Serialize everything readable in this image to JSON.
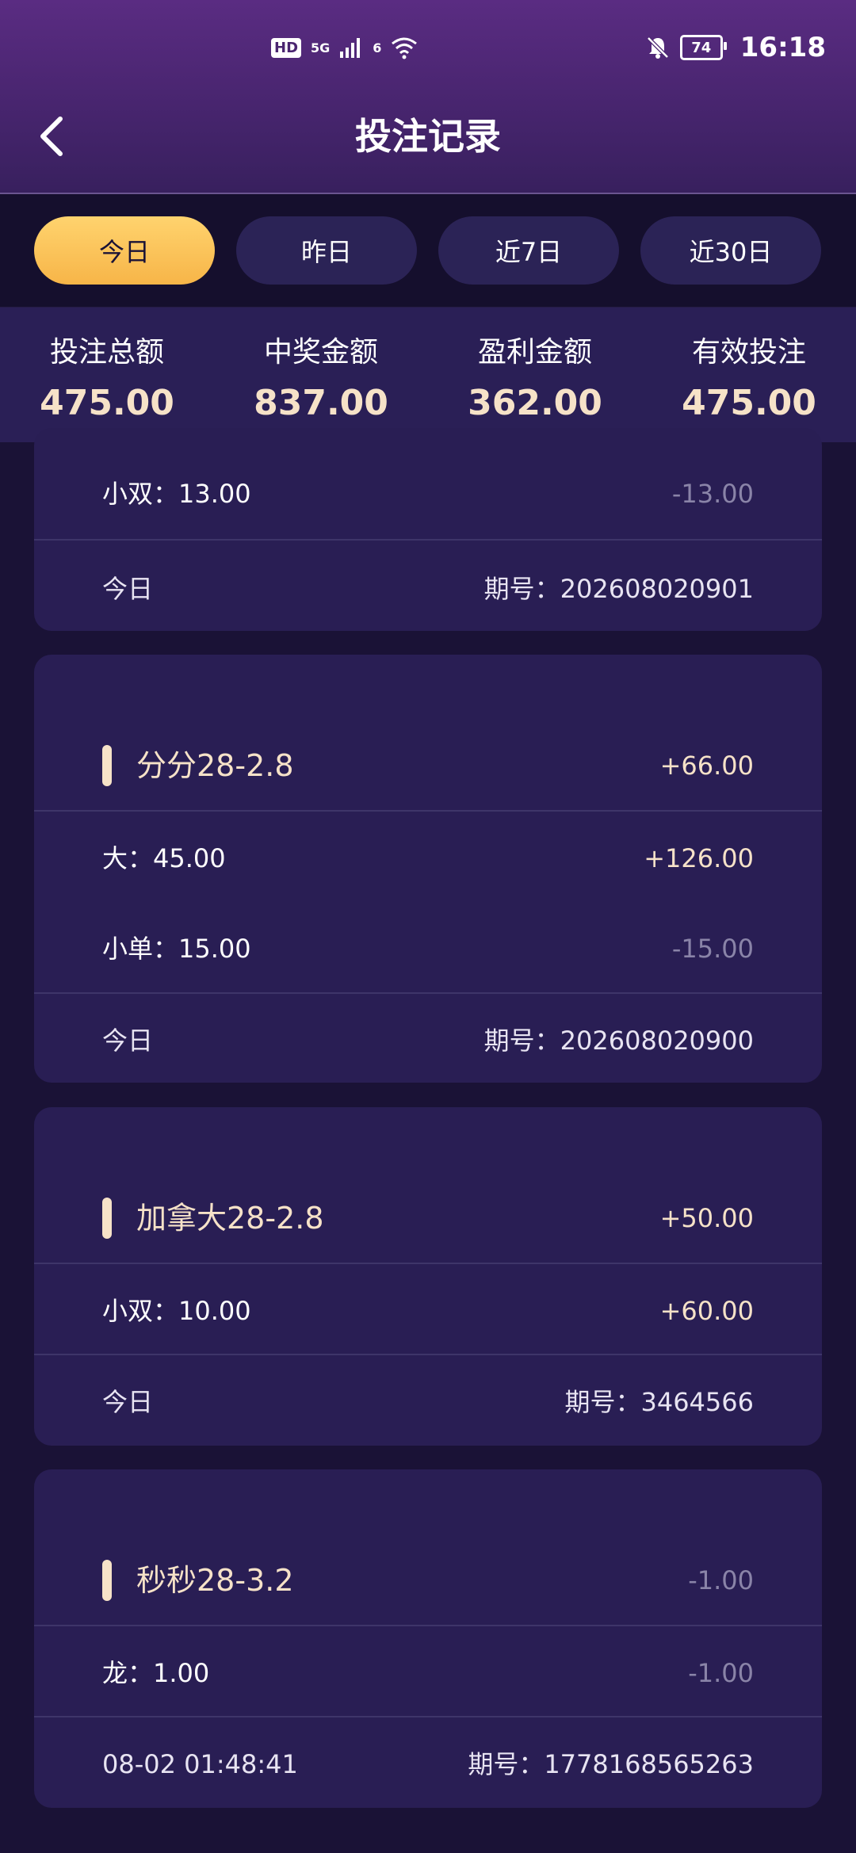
{
  "status_bar": {
    "hd": "HD",
    "network": "5G",
    "wifi_label": "6",
    "battery": "74",
    "time": "16:18"
  },
  "header": {
    "title": "投注记录"
  },
  "tabs": [
    {
      "label": "今日",
      "active": true
    },
    {
      "label": "昨日",
      "active": false
    },
    {
      "label": "近7日",
      "active": false
    },
    {
      "label": "近30日",
      "active": false
    }
  ],
  "summary": [
    {
      "label": "投注总额",
      "value": "475.00"
    },
    {
      "label": "中奖金额",
      "value": "837.00"
    },
    {
      "label": "盈利金额",
      "value": "362.00"
    },
    {
      "label": "有效投注",
      "value": "475.00"
    }
  ],
  "records": [
    {
      "bets": [
        {
          "label": "小双：13.00",
          "amount": "-13.00"
        }
      ],
      "date": "今日",
      "period": "期号：202608020901"
    },
    {
      "title": "分分28-2.8",
      "total": "+66.00",
      "bets": [
        {
          "label": "大：45.00",
          "amount": "+126.00"
        },
        {
          "label": "小单：15.00",
          "amount": "-15.00"
        }
      ],
      "date": "今日",
      "period": "期号：202608020900"
    },
    {
      "title": "加拿大28-2.8",
      "total": "+50.00",
      "bets": [
        {
          "label": "小双：10.00",
          "amount": "+60.00"
        }
      ],
      "date": "今日",
      "period": "期号：3464566"
    },
    {
      "title": "秒秒28-3.2",
      "total": "-1.00",
      "bets": [
        {
          "label": "龙：1.00",
          "amount": "-1.00"
        }
      ],
      "date": "08-02 01:48:41",
      "period": "期号：1778168565263"
    }
  ],
  "colors": {
    "accent_gold": "#f6e2c8",
    "tab_active": "#f7b548",
    "negative": "#8a84a8",
    "background": "#1a1236"
  }
}
